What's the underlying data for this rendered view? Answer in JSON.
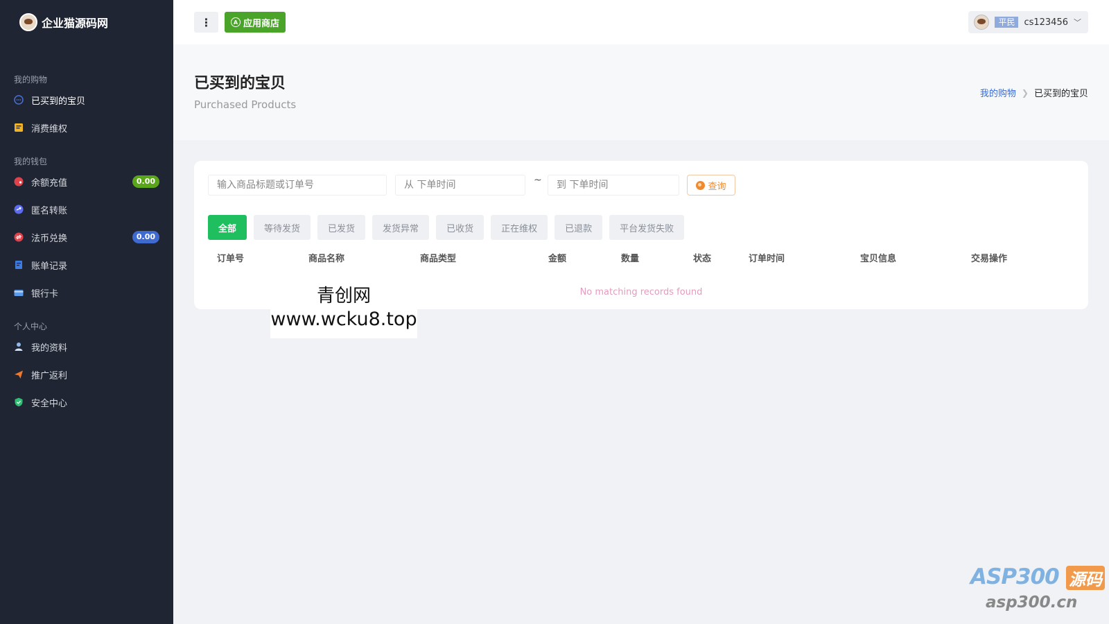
{
  "brand": {
    "name": "企业猫源码网"
  },
  "sidebar": {
    "sections": [
      {
        "title": "我的购物",
        "items": [
          {
            "label": "已买到的宝贝",
            "icon": "circle-dots-icon",
            "active": true
          },
          {
            "label": "消费维权",
            "icon": "receipt-icon"
          }
        ]
      },
      {
        "title": "我的钱包",
        "items": [
          {
            "label": "余额充值",
            "icon": "wallet-icon",
            "badge": "0.00"
          },
          {
            "label": "匿名转账",
            "icon": "transfer-icon"
          },
          {
            "label": "法币兑换",
            "icon": "exchange-icon",
            "badge": "0.00"
          },
          {
            "label": "账单记录",
            "icon": "bill-icon"
          },
          {
            "label": "银行卡",
            "icon": "card-icon"
          }
        ]
      },
      {
        "title": "个人中心",
        "items": [
          {
            "label": "我的资料",
            "icon": "user-icon"
          },
          {
            "label": "推广返利",
            "icon": "send-icon"
          },
          {
            "label": "安全中心",
            "icon": "shield-icon"
          }
        ]
      }
    ]
  },
  "topbar": {
    "store_label": "应用商店",
    "user": {
      "role": "平民",
      "name": "cs123456"
    }
  },
  "page": {
    "title": "已买到的宝贝",
    "subtitle": "Purchased Products",
    "breadcrumb": {
      "parent": "我的购物",
      "current": "已买到的宝贝"
    }
  },
  "filters": {
    "search_placeholder": "输入商品标题或订单号",
    "from_placeholder": "从 下单时间",
    "tilde": "~",
    "to_placeholder": "到 下单时间",
    "query_label": "查询"
  },
  "tabs": [
    "全部",
    "等待发货",
    "已发货",
    "发货异常",
    "已收货",
    "正在维权",
    "已退款",
    "平台发货失败"
  ],
  "table": {
    "columns": [
      "订单号",
      "商品名称",
      "商品类型",
      "金额",
      "数量",
      "状态",
      "订单时间",
      "宝贝信息",
      "交易操作"
    ],
    "empty_message": "No matching records found"
  },
  "watermarks": {
    "site_name": "青创网",
    "site_url": "www.wcku8.top",
    "asp_logo": "ASP300",
    "asp_tag": "源码",
    "asp_url": "asp300.cn"
  },
  "colors": {
    "sidebar_bg": "#1f2533",
    "accent_green": "#1fbf5f",
    "store_green": "#4aa42a",
    "link_blue": "#3a6bd1",
    "query_orange": "#f08a2c"
  }
}
